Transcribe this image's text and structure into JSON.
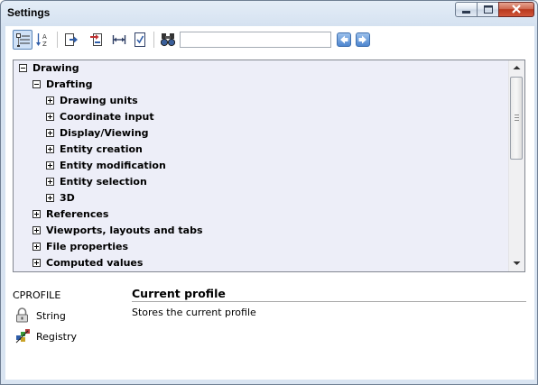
{
  "window": {
    "title": "Settings",
    "controls": {
      "minimize": "minimize",
      "maximize": "maximize",
      "close": "close"
    }
  },
  "toolbar": {
    "buttons": [
      {
        "name": "categorized-view-icon",
        "active": true
      },
      {
        "name": "sort-alphabetical-icon",
        "active": false
      },
      {
        "name": "export-icon",
        "active": false
      },
      {
        "name": "import-icon",
        "active": false
      },
      {
        "name": "dimension-icon",
        "active": false
      },
      {
        "name": "checklist-icon",
        "active": false
      },
      {
        "name": "find-binoculars-icon",
        "active": false
      }
    ],
    "search": {
      "value": "",
      "placeholder": ""
    },
    "nav": {
      "prev": "arrow-left-icon",
      "next": "arrow-right-icon"
    }
  },
  "tree": {
    "items": [
      {
        "label": "Drawing",
        "level": 0,
        "expanded": true
      },
      {
        "label": "Drafting",
        "level": 1,
        "expanded": true
      },
      {
        "label": "Drawing units",
        "level": 2,
        "expanded": false
      },
      {
        "label": "Coordinate input",
        "level": 2,
        "expanded": false
      },
      {
        "label": "Display/Viewing",
        "level": 2,
        "expanded": false
      },
      {
        "label": "Entity creation",
        "level": 2,
        "expanded": false
      },
      {
        "label": "Entity modification",
        "level": 2,
        "expanded": false
      },
      {
        "label": "Entity selection",
        "level": 2,
        "expanded": false
      },
      {
        "label": "3D",
        "level": 2,
        "expanded": false
      },
      {
        "label": "References",
        "level": 1,
        "expanded": false
      },
      {
        "label": "Viewports, layouts and tabs",
        "level": 1,
        "expanded": false
      },
      {
        "label": "File properties",
        "level": 1,
        "expanded": false
      },
      {
        "label": "Computed values",
        "level": 1,
        "expanded": false
      }
    ]
  },
  "details": {
    "variable": "CPROFILE",
    "type": "String",
    "type_icon": "lock-icon",
    "source": "Registry",
    "source_icon": "registry-icon",
    "title": "Current profile",
    "description": "Stores the current profile"
  },
  "colors": {
    "tree_background": "#edeef8",
    "window_frame": "#d4e1f0",
    "close_button": "#c2492f",
    "nav_button": "#4e86cf"
  }
}
